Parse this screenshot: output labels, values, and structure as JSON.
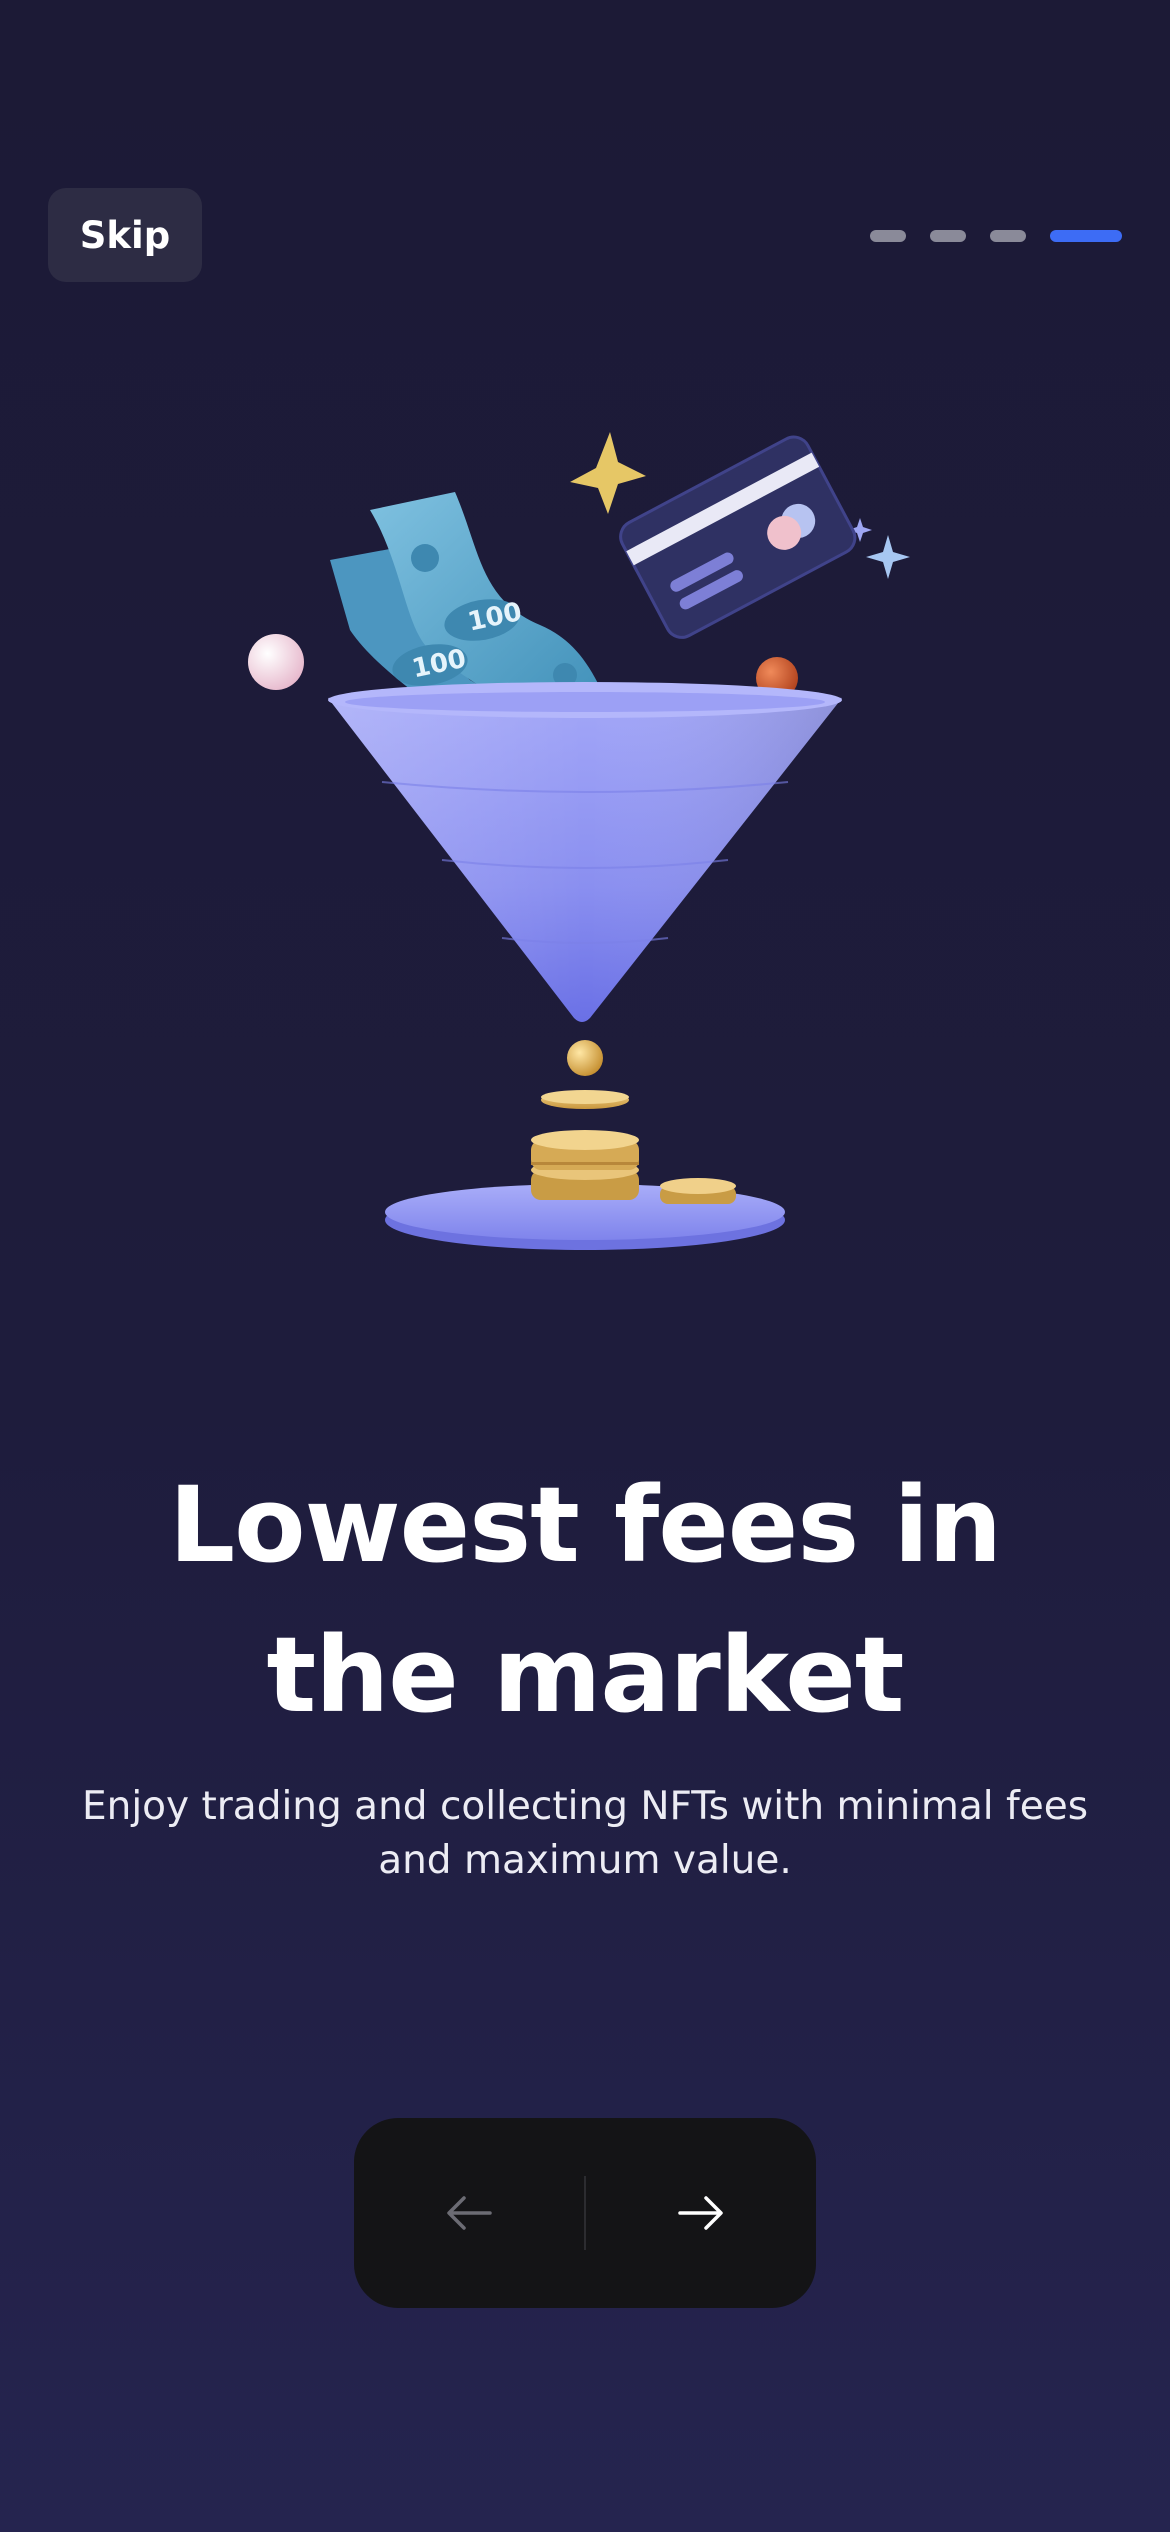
{
  "header": {
    "skip_label": "Skip"
  },
  "pagination": {
    "total_steps": 4,
    "current_step": 4
  },
  "content": {
    "title": "Lowest fees in the market",
    "subtitle": "Enjoy trading and collecting NFTs with minimal fees and maximum value."
  },
  "navigation": {
    "prev_icon": "arrow-left-icon",
    "next_icon": "arrow-right-icon"
  },
  "illustration": {
    "icon": "fee-funnel-illustration",
    "banknote_text": "100"
  },
  "colors": {
    "background": "#1c1a36",
    "accent": "#3d6cf5",
    "inactive_dot": "#8a8a99",
    "funnel": "#8f93f2",
    "gold": "#d9b35e"
  }
}
